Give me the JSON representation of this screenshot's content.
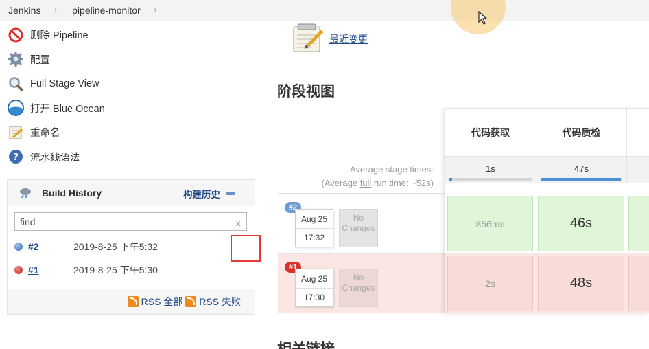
{
  "breadcrumb": {
    "items": [
      "Jenkins",
      "pipeline-monitor"
    ],
    "separator": "›"
  },
  "tasks": [
    {
      "label": "删除 Pipeline",
      "icon": "delete-icon"
    },
    {
      "label": "配置",
      "icon": "gear-icon"
    },
    {
      "label": "Full Stage View",
      "icon": "magnifier-icon"
    },
    {
      "label": "打开 Blue Ocean",
      "icon": "blue-ocean-icon"
    },
    {
      "label": "重命名",
      "icon": "notepad-icon"
    },
    {
      "label": "流水线语法",
      "icon": "help-icon"
    }
  ],
  "build_history": {
    "title": "Build History",
    "trend_link": "构建历史",
    "search_placeholder": "find",
    "search_value": "find",
    "clear_label": "x",
    "builds": [
      {
        "number": "#2",
        "date": "2019-8-25 下午5:32",
        "status": "success",
        "color": "#4a7fc1"
      },
      {
        "number": "#1",
        "date": "2019-8-25 下午5:30",
        "status": "failed",
        "color": "#d9312b"
      }
    ],
    "rss_all": "RSS 全部",
    "rss_failed": "RSS 失败"
  },
  "main": {
    "recent_changes": "最近变更",
    "stage_view_title": "阶段视图",
    "avg_stage_times": "Average stage times:",
    "avg_full_run_prefix": "(Average ",
    "avg_full_run_word": "full",
    "avg_full_run_suffix": " run time: ~52s)",
    "stages": [
      {
        "name": "代码获取",
        "avg": "1s",
        "avg_fraction": 0.02
      },
      {
        "name": "代码质检",
        "avg": "47s",
        "avg_fraction": 0.98
      },
      {
        "name": "",
        "avg": "",
        "avg_fraction": 0
      }
    ],
    "runs": [
      {
        "badge": "#2",
        "badge_color": "#6b9ad6",
        "date": "Aug 25",
        "time": "17:32",
        "changes": "No Changes",
        "status": "success",
        "cells": [
          "856ms",
          "46s",
          ""
        ]
      },
      {
        "badge": "#1",
        "badge_color": "#d9312b",
        "date": "Aug 25",
        "time": "17:30",
        "changes": "No Changes",
        "status": "failed",
        "cells": [
          "2s",
          "48s",
          ""
        ]
      }
    ],
    "related_links": "相关链接"
  },
  "colors": {
    "link": "#204a87",
    "success_cell": "#dff6d9",
    "failed_cell": "#f8dcd7",
    "failed_row": "#fbe6e3",
    "highlight_box": "#e53935"
  }
}
